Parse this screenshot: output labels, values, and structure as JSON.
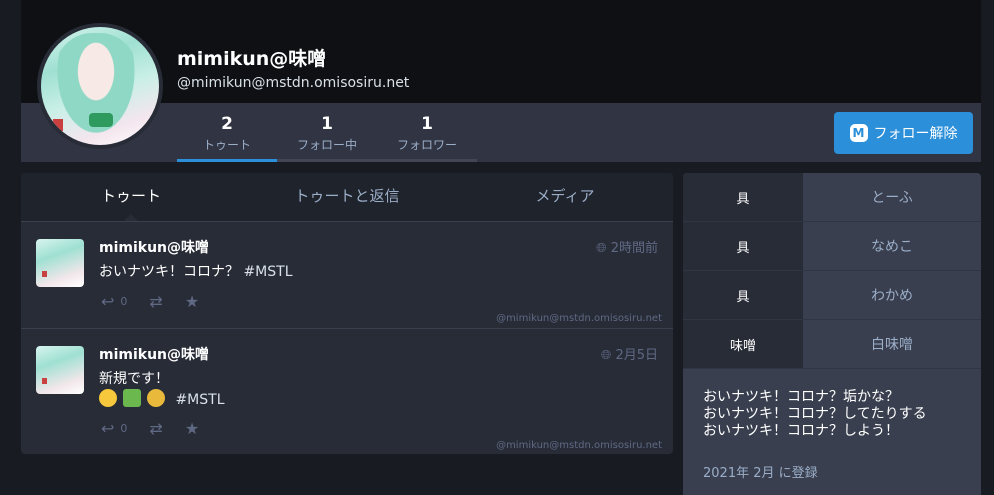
{
  "profile": {
    "display_name": "mimikun@味噌",
    "acct": "@mimikun@mstdn.omisosiru.net"
  },
  "counts": [
    {
      "num": "2",
      "label": "トゥート"
    },
    {
      "num": "1",
      "label": "フォロー中"
    },
    {
      "num": "1",
      "label": "フォロワー"
    }
  ],
  "follow_button": {
    "label": "フォロー解除",
    "icon": "mastodon-icon"
  },
  "timeline_tabs": [
    "トゥート",
    "トゥートと返信",
    "メディア"
  ],
  "statuses": [
    {
      "name": "mimikun@味噌",
      "time": "2時間前",
      "text": "おいナツキ！コロナ？",
      "hashtag": "#MSTL",
      "reply_count": "0",
      "acct": "@mimikun@mstdn.omisosiru.net"
    },
    {
      "name": "mimikun@味噌",
      "time": "2月5日",
      "text": "新規です！",
      "hashtag": "#MSTL",
      "reply_count": "0",
      "acct": "@mimikun@mstdn.omisosiru.net"
    }
  ],
  "fields": [
    {
      "name": "具",
      "value": "とーふ"
    },
    {
      "name": "具",
      "value": "なめこ"
    },
    {
      "name": "具",
      "value": "わかめ"
    },
    {
      "name": "味噌",
      "value": "白味噌"
    }
  ],
  "bio": [
    "おいナツキ！コロナ？垢かな？",
    "おいナツキ！コロナ？してたりする",
    "おいナツキ！コロナ？しよう！"
  ],
  "joined": "2021年 2月 に登録",
  "colors": {
    "accent": "#2b90d9",
    "background": "#191b22",
    "panel": "#282c37"
  }
}
